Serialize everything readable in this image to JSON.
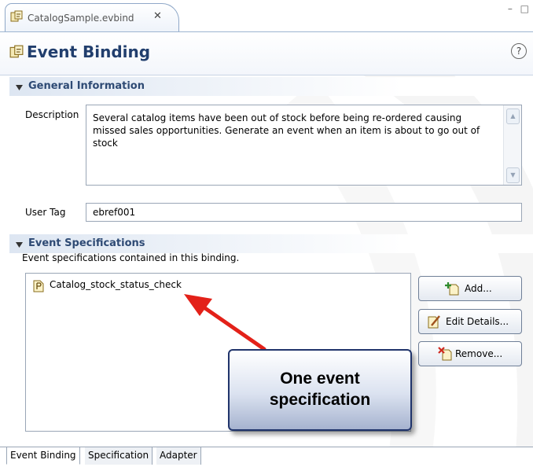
{
  "editor_tab": {
    "title": "CatalogSample.evbind",
    "close_glyph": "✕"
  },
  "window_controls": "– □",
  "form": {
    "title": "Event Binding",
    "help_glyph": "?"
  },
  "general_section": {
    "title": "General Information",
    "description_label": "Description",
    "description_value": "Several catalog items have been out of stock before being re-ordered causing missed sales opportunities. Generate an event when an item is about to go out of stock",
    "user_tag_label": "User Tag",
    "user_tag_value": "ebref001"
  },
  "spec_section": {
    "title": "Event Specifications",
    "subtitle": "Event specifications contained in this binding.",
    "items": [
      {
        "label": "Catalog_stock_status_check"
      }
    ],
    "buttons": {
      "add": "Add...",
      "edit": "Edit Details...",
      "remove": "Remove..."
    }
  },
  "annotation": {
    "line1": "One event",
    "line2": "specification"
  },
  "bottom_tabs": [
    {
      "label": "Event Binding",
      "active": true
    },
    {
      "label": "Specification",
      "active": false
    },
    {
      "label": "Adapter",
      "active": false
    }
  ],
  "colors": {
    "header_title": "#213e6d",
    "section_title": "#2e4a74",
    "annotation_arrow": "#e32119",
    "callout_border": "#20346b"
  },
  "icons": {
    "editor_tab": "event-binding-icon",
    "list_item": "event-spec-icon",
    "add": "add-spec-icon",
    "edit": "edit-details-icon",
    "remove": "remove-spec-icon"
  }
}
